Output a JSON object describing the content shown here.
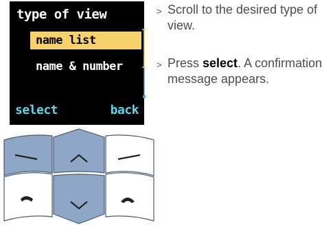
{
  "phone": {
    "title": "type of view",
    "items": [
      "name list",
      "name & number"
    ],
    "selected_index": 0,
    "left_softkey": "select",
    "right_softkey": "back",
    "colors": {
      "highlight": "#f7d26b",
      "softkey": "#5ad7e8",
      "scroll": "#4aa3e0"
    }
  },
  "instructions": {
    "bullet": ">",
    "step1": "Scroll to the desired type of view.",
    "step2_pre": "Press ",
    "step2_bold": "select",
    "step2_post": ". A confirmation message appears."
  }
}
